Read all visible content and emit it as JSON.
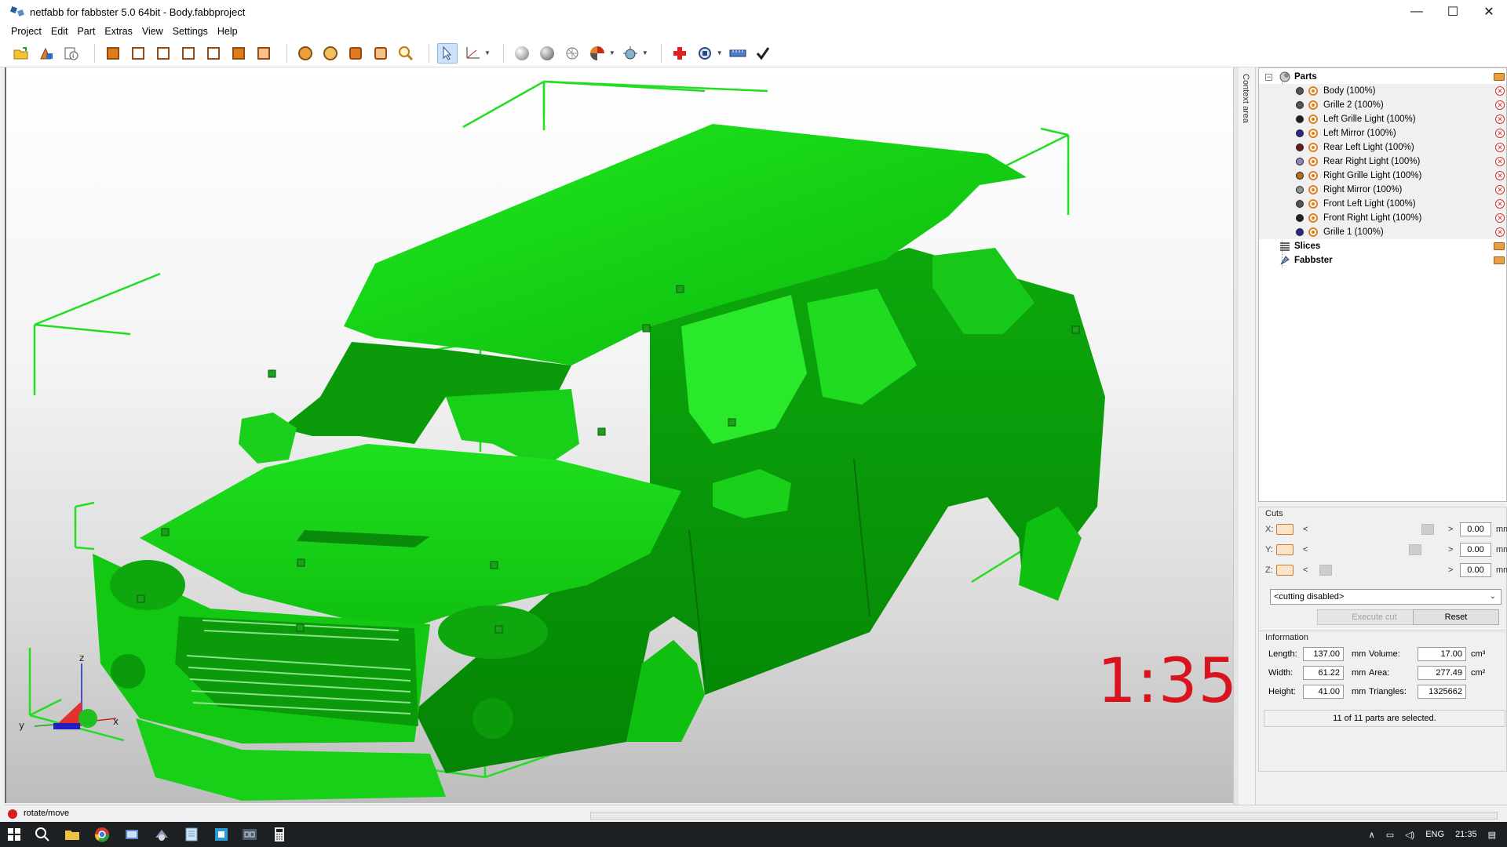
{
  "window": {
    "title": "netfabb for fabbster 5.0 64bit - Body.fabbproject",
    "minimize": "—",
    "maximize": "☐",
    "close": "✕"
  },
  "menu": [
    "Project",
    "Edit",
    "Part",
    "Extras",
    "View",
    "Settings",
    "Help"
  ],
  "toolbar": {
    "icons": [
      "open-project-icon",
      "add-part-icon",
      "part-info-icon",
      "view-front-icon",
      "view-back-icon",
      "view-left-icon",
      "view-right-icon",
      "view-top-icon",
      "view-bottom-icon",
      "view-iso-icon",
      "zoom-all-icon",
      "zoom-parts-icon",
      "zoom-selection-icon",
      "zoom-icon",
      "select-arrow-icon",
      "measure-axis-icon",
      "shading-smooth-icon",
      "shading-flat-icon",
      "mesh-icon",
      "color-ball-icon",
      "light-icon",
      "repair-icon",
      "rotate-icon",
      "ruler-icon",
      "check-icon"
    ]
  },
  "viewport": {
    "context_tab": "Context area",
    "scale_text": "1:35",
    "axis_labels": {
      "x": "x",
      "y": "y",
      "z": "z"
    },
    "model_color": "#16e016"
  },
  "tree": {
    "parts_label": "Parts",
    "parts": [
      {
        "name": "Body (100%)",
        "color": "#555555"
      },
      {
        "name": "Grille 2 (100%)",
        "color": "#555555"
      },
      {
        "name": "Left Grille Light (100%)",
        "color": "#222222"
      },
      {
        "name": "Left Mirror (100%)",
        "color": "#2a2a8a"
      },
      {
        "name": "Rear Left Light (100%)",
        "color": "#6a1a1a"
      },
      {
        "name": "Rear Right Light (100%)",
        "color": "#8a8ab8"
      },
      {
        "name": "Right Grille Light (100%)",
        "color": "#b86a10"
      },
      {
        "name": "Right Mirror (100%)",
        "color": "#8a9a8a"
      },
      {
        "name": "Front Left Light (100%)",
        "color": "#555555"
      },
      {
        "name": "Front Right Light (100%)",
        "color": "#222222"
      },
      {
        "name": "Grille 1 (100%)",
        "color": "#2a2a8a"
      }
    ],
    "slices_label": "Slices",
    "fabbster_label": "Fabbster"
  },
  "cuts": {
    "title": "Cuts",
    "rows": [
      {
        "axis": "X:",
        "value": "0.00",
        "unit": "mm",
        "slider": 0.95
      },
      {
        "axis": "Y:",
        "value": "0.00",
        "unit": "mm",
        "slider": 0.84
      },
      {
        "axis": "Z:",
        "value": "0.00",
        "unit": "mm",
        "slider": 0.05
      }
    ],
    "mode_value": "<cutting disabled>",
    "execute_label": "Execute cut",
    "reset_label": "Reset"
  },
  "information": {
    "title": "Information",
    "length_label": "Length:",
    "length": "137.00",
    "length_unit": "mm",
    "width_label": "Width:",
    "width": "61.22",
    "width_unit": "mm",
    "height_label": "Height:",
    "height": "41.00",
    "height_unit": "mm",
    "volume_label": "Volume:",
    "volume": "17.00",
    "volume_unit": "cm³",
    "area_label": "Area:",
    "area": "277.49",
    "area_unit": "cm²",
    "triangles_label": "Triangles:",
    "triangles": "1325662",
    "selection_status": "11 of 11 parts are selected."
  },
  "statusbar": {
    "mode": "rotate/move"
  },
  "taskbar": {
    "apps": [
      "search-icon",
      "file-explorer-icon",
      "chrome-icon",
      "app-icon-1",
      "app-icon-2",
      "notepad-icon",
      "app-icon-3",
      "netfabb-icon",
      "calculator-icon"
    ],
    "language": "ENG",
    "time": "21:35"
  }
}
